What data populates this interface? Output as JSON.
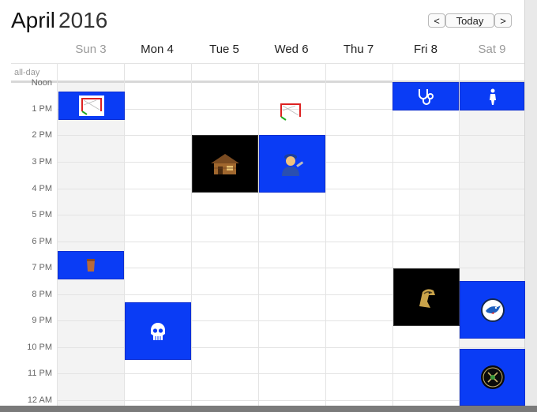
{
  "header": {
    "month": "April",
    "year": "2016"
  },
  "nav": {
    "prev": "<",
    "today": "Today",
    "next": ">"
  },
  "days": [
    "Sun 3",
    "Mon 4",
    "Tue 5",
    "Wed 6",
    "Thu 7",
    "Fri 8",
    "Sat 9"
  ],
  "allday_label": "all-day",
  "hours": [
    "Noon",
    "1 PM",
    "2 PM",
    "3 PM",
    "4 PM",
    "5 PM",
    "6 PM",
    "7 PM",
    "8 PM",
    "9 PM",
    "10 PM",
    "11 PM",
    "12 AM"
  ],
  "colors": {
    "event_blue": "#0a3cf5",
    "event_dark": "#000000"
  },
  "events": [
    {
      "day": "Sun 3",
      "icon": "hockey-net-icon"
    },
    {
      "day": "Wed 6",
      "icon": "hockey-net-icon"
    },
    {
      "day": "Fri 8",
      "icon": "stethoscope-icon"
    },
    {
      "day": "Sat 9",
      "icon": "person-icon"
    },
    {
      "day": "Tue 5",
      "icon": "cabin-icon"
    },
    {
      "day": "Wed 6",
      "icon": "mechanic-icon"
    },
    {
      "day": "Sun 3",
      "icon": "cup-icon"
    },
    {
      "day": "Mon 4",
      "icon": "skull-icon"
    },
    {
      "day": "Fri 8",
      "icon": "eagle-logo-icon"
    },
    {
      "day": "Sat 9",
      "icon": "bluejays-logo-icon"
    },
    {
      "day": "Sat 9",
      "icon": "round-badge-icon"
    }
  ]
}
